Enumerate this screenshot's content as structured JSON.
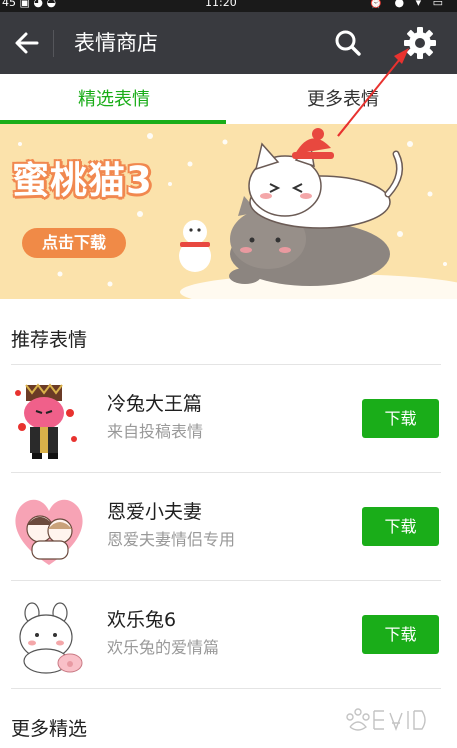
{
  "status_bar": {
    "left": "45 ▣ ◕ ◒",
    "time": "11:20",
    "right": "⏰ ● ▾ ▭"
  },
  "header": {
    "title": "表情商店",
    "back_icon": "arrow-left-icon",
    "search_icon": "search-icon",
    "settings_icon": "gear-icon"
  },
  "tabs": [
    {
      "label": "精选表情",
      "active": true
    },
    {
      "label": "更多表情",
      "active": false
    }
  ],
  "banner": {
    "title": "蜜桃猫3",
    "cta": "点击下载"
  },
  "recommended": {
    "title": "推荐表情",
    "items": [
      {
        "name": "冷兔大王篇",
        "desc": "来自投稿表情",
        "button": "下载"
      },
      {
        "name": "恩爱小夫妻",
        "desc": "恩爱夫妻情侣专用",
        "button": "下载"
      },
      {
        "name": "欢乐兔6",
        "desc": "欢乐兔的爱情篇",
        "button": "下载"
      }
    ]
  },
  "more": {
    "title": "更多精选"
  },
  "colors": {
    "accent": "#1aad19",
    "appbar": "#393a3f",
    "banner_bg": "#fbe2ab",
    "annotation_arrow": "#e8322f"
  }
}
